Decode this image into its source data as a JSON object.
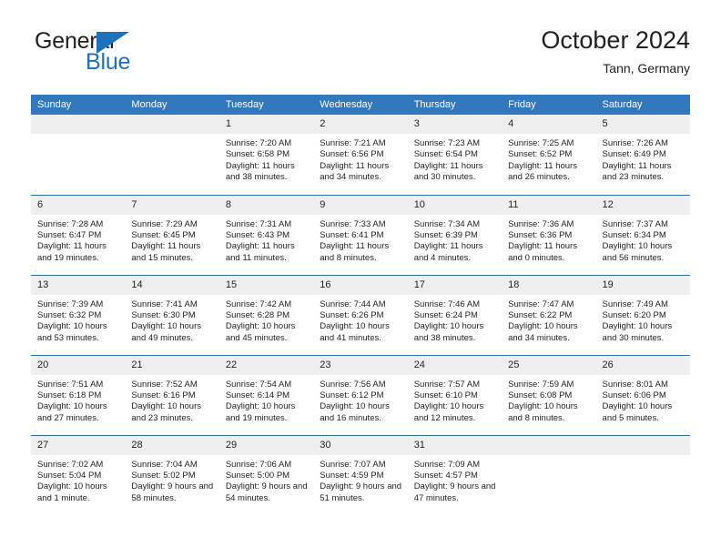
{
  "brand": {
    "name_top": "General",
    "name_bottom": "Blue",
    "accent_color": "#1e72bb"
  },
  "header": {
    "title": "October 2024",
    "subtitle": "Tann, Germany"
  },
  "theme": {
    "header_row_bg": "#3278bd",
    "row_divider": "#2f6fae",
    "daynum_bg": "#efefef",
    "text": "#231f20"
  },
  "weekday_headers": [
    "Sunday",
    "Monday",
    "Tuesday",
    "Wednesday",
    "Thursday",
    "Friday",
    "Saturday"
  ],
  "weeks": [
    [
      {
        "day": "",
        "lines": []
      },
      {
        "day": "",
        "lines": []
      },
      {
        "day": "1",
        "lines": [
          "Sunrise: 7:20 AM",
          "Sunset: 6:58 PM",
          "Daylight: 11 hours and 38 minutes."
        ]
      },
      {
        "day": "2",
        "lines": [
          "Sunrise: 7:21 AM",
          "Sunset: 6:56 PM",
          "Daylight: 11 hours and 34 minutes."
        ]
      },
      {
        "day": "3",
        "lines": [
          "Sunrise: 7:23 AM",
          "Sunset: 6:54 PM",
          "Daylight: 11 hours and 30 minutes."
        ]
      },
      {
        "day": "4",
        "lines": [
          "Sunrise: 7:25 AM",
          "Sunset: 6:52 PM",
          "Daylight: 11 hours and 26 minutes."
        ]
      },
      {
        "day": "5",
        "lines": [
          "Sunrise: 7:26 AM",
          "Sunset: 6:49 PM",
          "Daylight: 11 hours and 23 minutes."
        ]
      }
    ],
    [
      {
        "day": "6",
        "lines": [
          "Sunrise: 7:28 AM",
          "Sunset: 6:47 PM",
          "Daylight: 11 hours and 19 minutes."
        ]
      },
      {
        "day": "7",
        "lines": [
          "Sunrise: 7:29 AM",
          "Sunset: 6:45 PM",
          "Daylight: 11 hours and 15 minutes."
        ]
      },
      {
        "day": "8",
        "lines": [
          "Sunrise: 7:31 AM",
          "Sunset: 6:43 PM",
          "Daylight: 11 hours and 11 minutes."
        ]
      },
      {
        "day": "9",
        "lines": [
          "Sunrise: 7:33 AM",
          "Sunset: 6:41 PM",
          "Daylight: 11 hours and 8 minutes."
        ]
      },
      {
        "day": "10",
        "lines": [
          "Sunrise: 7:34 AM",
          "Sunset: 6:39 PM",
          "Daylight: 11 hours and 4 minutes."
        ]
      },
      {
        "day": "11",
        "lines": [
          "Sunrise: 7:36 AM",
          "Sunset: 6:36 PM",
          "Daylight: 11 hours and 0 minutes."
        ]
      },
      {
        "day": "12",
        "lines": [
          "Sunrise: 7:37 AM",
          "Sunset: 6:34 PM",
          "Daylight: 10 hours and 56 minutes."
        ]
      }
    ],
    [
      {
        "day": "13",
        "lines": [
          "Sunrise: 7:39 AM",
          "Sunset: 6:32 PM",
          "Daylight: 10 hours and 53 minutes."
        ]
      },
      {
        "day": "14",
        "lines": [
          "Sunrise: 7:41 AM",
          "Sunset: 6:30 PM",
          "Daylight: 10 hours and 49 minutes."
        ]
      },
      {
        "day": "15",
        "lines": [
          "Sunrise: 7:42 AM",
          "Sunset: 6:28 PM",
          "Daylight: 10 hours and 45 minutes."
        ]
      },
      {
        "day": "16",
        "lines": [
          "Sunrise: 7:44 AM",
          "Sunset: 6:26 PM",
          "Daylight: 10 hours and 41 minutes."
        ]
      },
      {
        "day": "17",
        "lines": [
          "Sunrise: 7:46 AM",
          "Sunset: 6:24 PM",
          "Daylight: 10 hours and 38 minutes."
        ]
      },
      {
        "day": "18",
        "lines": [
          "Sunrise: 7:47 AM",
          "Sunset: 6:22 PM",
          "Daylight: 10 hours and 34 minutes."
        ]
      },
      {
        "day": "19",
        "lines": [
          "Sunrise: 7:49 AM",
          "Sunset: 6:20 PM",
          "Daylight: 10 hours and 30 minutes."
        ]
      }
    ],
    [
      {
        "day": "20",
        "lines": [
          "Sunrise: 7:51 AM",
          "Sunset: 6:18 PM",
          "Daylight: 10 hours and 27 minutes."
        ]
      },
      {
        "day": "21",
        "lines": [
          "Sunrise: 7:52 AM",
          "Sunset: 6:16 PM",
          "Daylight: 10 hours and 23 minutes."
        ]
      },
      {
        "day": "22",
        "lines": [
          "Sunrise: 7:54 AM",
          "Sunset: 6:14 PM",
          "Daylight: 10 hours and 19 minutes."
        ]
      },
      {
        "day": "23",
        "lines": [
          "Sunrise: 7:56 AM",
          "Sunset: 6:12 PM",
          "Daylight: 10 hours and 16 minutes."
        ]
      },
      {
        "day": "24",
        "lines": [
          "Sunrise: 7:57 AM",
          "Sunset: 6:10 PM",
          "Daylight: 10 hours and 12 minutes."
        ]
      },
      {
        "day": "25",
        "lines": [
          "Sunrise: 7:59 AM",
          "Sunset: 6:08 PM",
          "Daylight: 10 hours and 8 minutes."
        ]
      },
      {
        "day": "26",
        "lines": [
          "Sunrise: 8:01 AM",
          "Sunset: 6:06 PM",
          "Daylight: 10 hours and 5 minutes."
        ]
      }
    ],
    [
      {
        "day": "27",
        "lines": [
          "Sunrise: 7:02 AM",
          "Sunset: 5:04 PM",
          "Daylight: 10 hours and 1 minute."
        ]
      },
      {
        "day": "28",
        "lines": [
          "Sunrise: 7:04 AM",
          "Sunset: 5:02 PM",
          "Daylight: 9 hours and 58 minutes."
        ]
      },
      {
        "day": "29",
        "lines": [
          "Sunrise: 7:06 AM",
          "Sunset: 5:00 PM",
          "Daylight: 9 hours and 54 minutes."
        ]
      },
      {
        "day": "30",
        "lines": [
          "Sunrise: 7:07 AM",
          "Sunset: 4:59 PM",
          "Daylight: 9 hours and 51 minutes."
        ]
      },
      {
        "day": "31",
        "lines": [
          "Sunrise: 7:09 AM",
          "Sunset: 4:57 PM",
          "Daylight: 9 hours and 47 minutes."
        ]
      },
      {
        "day": "",
        "lines": []
      },
      {
        "day": "",
        "lines": []
      }
    ]
  ]
}
